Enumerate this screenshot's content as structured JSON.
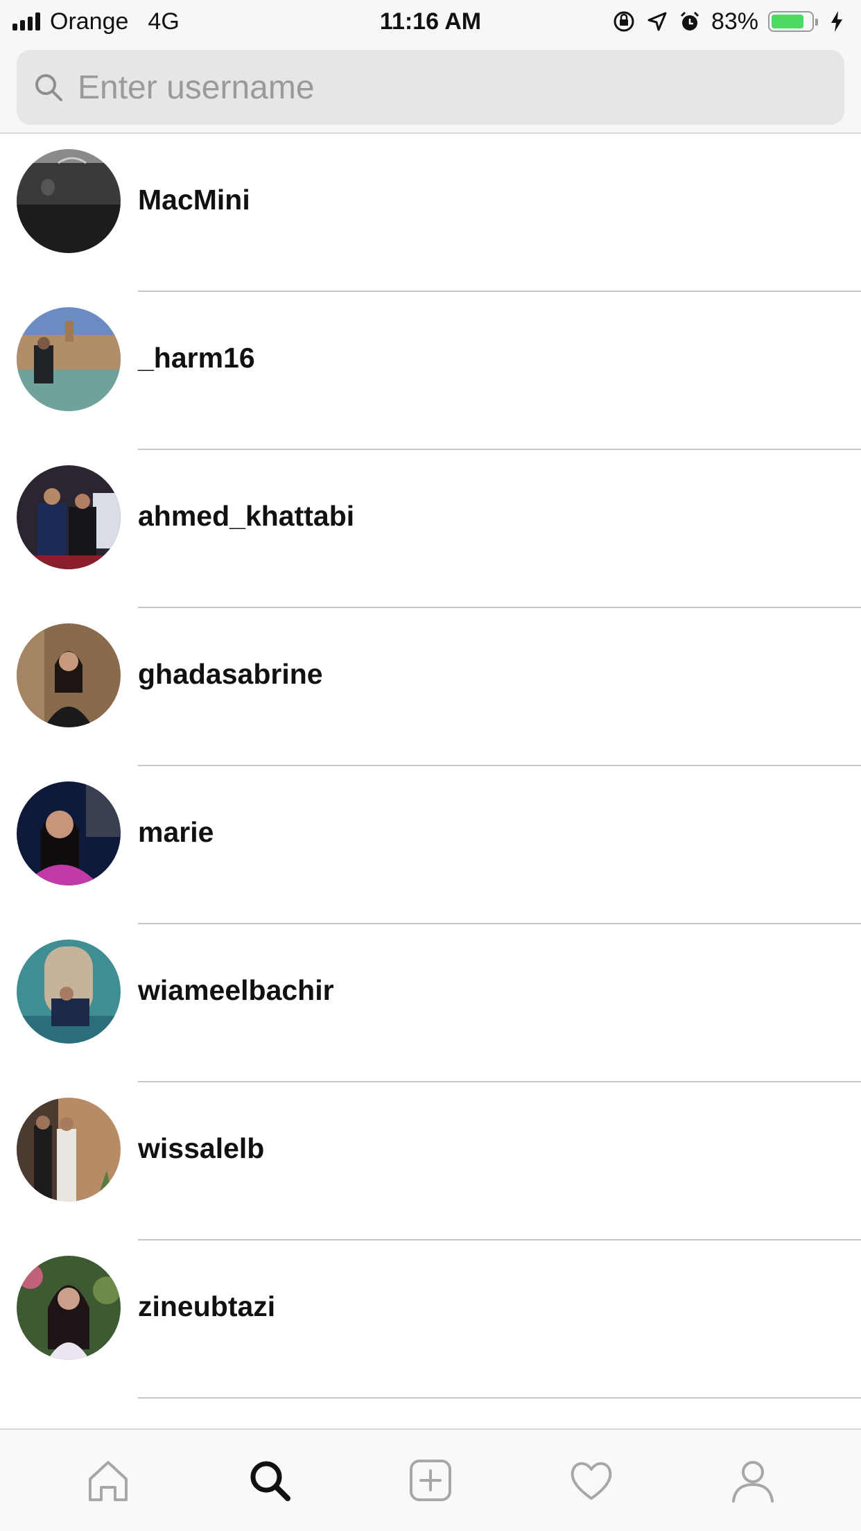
{
  "status_bar": {
    "carrier": "Orange",
    "network": "4G",
    "time": "11:16 AM",
    "battery_percent": "83%",
    "battery_level": 0.83,
    "battery_color": "#4cd964"
  },
  "search": {
    "placeholder": "Enter username",
    "value": ""
  },
  "users": [
    {
      "username": "MacMini",
      "avatar": "macmini-photo"
    },
    {
      "username": "_harm16",
      "avatar": "plaza-photo"
    },
    {
      "username": "ahmed_khattabi",
      "avatar": "couple-photo"
    },
    {
      "username": "ghadasabrine",
      "avatar": "woman-portrait-photo"
    },
    {
      "username": "marie",
      "avatar": "selfie-photo"
    },
    {
      "username": "wiameelbachir",
      "avatar": "tiled-wall-photo"
    },
    {
      "username": "wissalelb",
      "avatar": "two-people-photo"
    },
    {
      "username": "zineubtazi",
      "avatar": "garden-portrait-photo"
    }
  ],
  "tab_bar": {
    "tabs": [
      {
        "icon": "home-icon",
        "active": false
      },
      {
        "icon": "search-icon",
        "active": true
      },
      {
        "icon": "add-post-icon",
        "active": false
      },
      {
        "icon": "heart-icon",
        "active": false
      },
      {
        "icon": "profile-icon",
        "active": false
      }
    ],
    "active_color": "#111111",
    "inactive_color": "#a7a7a7"
  }
}
